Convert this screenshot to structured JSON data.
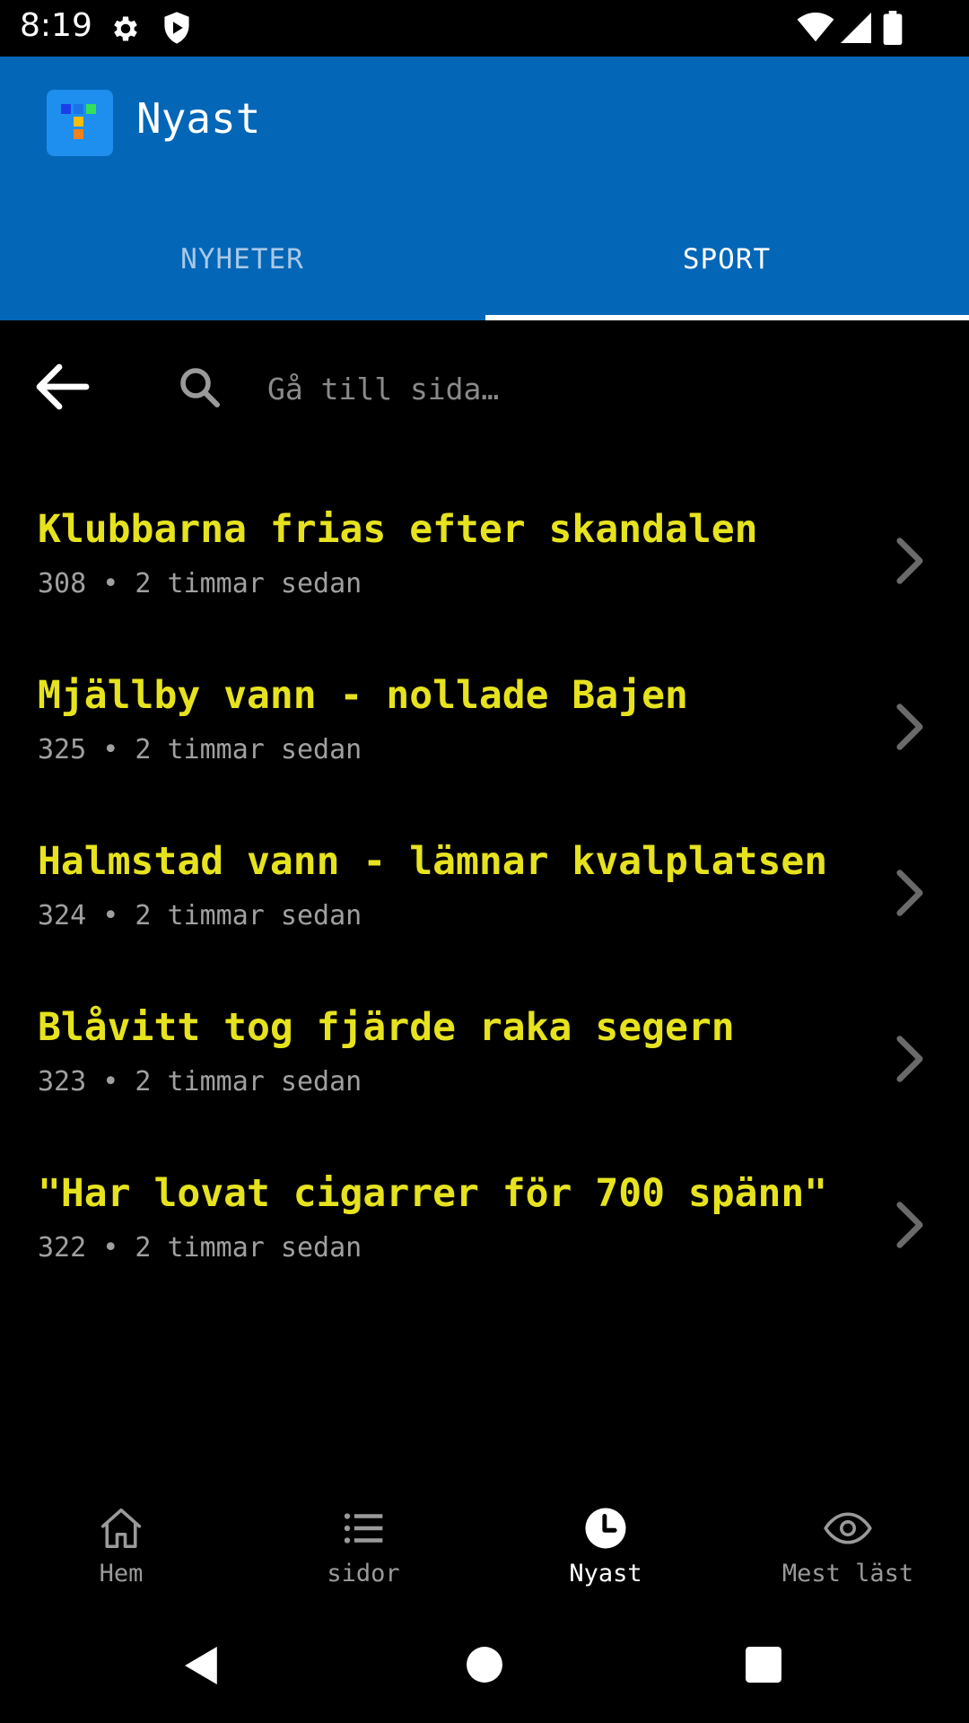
{
  "status_bar": {
    "time": "8:19",
    "icons": [
      "settings-icon",
      "shield-icon",
      "wifi-icon",
      "signal-icon",
      "battery-icon"
    ]
  },
  "app_bar": {
    "title": "Nyast",
    "logo_colors": [
      "#1a73e8",
      "#34c759",
      "#fbbc04",
      "#f4511e"
    ],
    "background": "#0366b7"
  },
  "tabs": [
    {
      "label": "NYHETER",
      "selected": false
    },
    {
      "label": "SPORT",
      "selected": true
    }
  ],
  "search": {
    "placeholder": "Gå till sida…",
    "value": ""
  },
  "news": [
    {
      "title": "Klubbarna frias efter skandalen",
      "meta": "308 • 2 timmar sedan"
    },
    {
      "title": "Mjällby vann - nollade Bajen",
      "meta": "325 • 2 timmar sedan"
    },
    {
      "title": "Halmstad vann - lämnar kvalplatsen",
      "meta": "324 • 2 timmar sedan"
    },
    {
      "title": "Blåvitt tog fjärde raka segern",
      "meta": "323 • 2 timmar sedan"
    },
    {
      "title": "\"Har lovat cigarrer för 700 spänn\"",
      "meta": "322 • 2 timmar sedan"
    }
  ],
  "bottom_nav": [
    {
      "label": "Hem",
      "icon": "home-icon",
      "active": false
    },
    {
      "label": "sidor",
      "icon": "list-icon",
      "active": false
    },
    {
      "label": "Nyast",
      "icon": "clock-icon",
      "active": true
    },
    {
      "label": "Mest läst",
      "icon": "eye-icon",
      "active": false
    }
  ],
  "colors": {
    "headline": "#e6e21e",
    "meta": "#a0a0a0",
    "accent": "#0366b7"
  }
}
